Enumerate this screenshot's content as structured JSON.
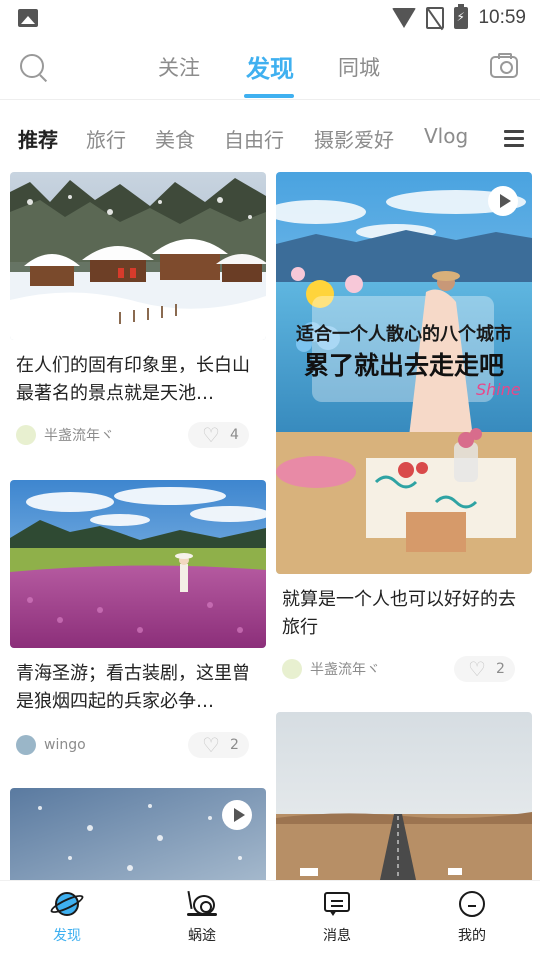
{
  "status_bar": {
    "time": "10:59"
  },
  "top_tabs": [
    {
      "label": "关注",
      "active": false
    },
    {
      "label": "发现",
      "active": true
    },
    {
      "label": "同城",
      "active": false
    }
  ],
  "categories": [
    {
      "label": "推荐",
      "active": true
    },
    {
      "label": "旅行",
      "active": false
    },
    {
      "label": "美食",
      "active": false
    },
    {
      "label": "自由行",
      "active": false
    },
    {
      "label": "摄影爱好",
      "active": false
    },
    {
      "label": "Vlog",
      "active": false
    }
  ],
  "feed": {
    "left": [
      {
        "title": "在人们的固有印象里，长白山最著名的景点就是天池…",
        "author": "半盏流年ヾ",
        "likes": "4",
        "image": "snowy-village",
        "is_video": false
      },
      {
        "title": "青海圣游；看古装剧，这里曾是狼烟四起的兵家必争…",
        "author": "wingo",
        "likes": "2",
        "image": "flower-field",
        "is_video": false
      },
      {
        "title": "",
        "author": "",
        "likes": "",
        "image": "snowy-blue",
        "is_video": true
      }
    ],
    "right": [
      {
        "title": "就算是一个人也可以好好的去旅行",
        "author": "半盏流年ヾ",
        "likes": "2",
        "image": "lakeside-picnic",
        "is_video": true,
        "overlay_line1": "适合一个人散心的八个城市",
        "overlay_line2": "累了就出去走走吧",
        "overlay_script": "Shine"
      },
      {
        "title": "",
        "author": "",
        "likes": "",
        "image": "desert-road",
        "is_video": false
      }
    ]
  },
  "bottom_nav": [
    {
      "label": "发现",
      "icon": "planet-icon",
      "active": true
    },
    {
      "label": "蜗途",
      "icon": "snail-icon",
      "active": false
    },
    {
      "label": "消息",
      "icon": "message-icon",
      "active": false
    },
    {
      "label": "我的",
      "icon": "profile-icon",
      "active": false
    }
  ],
  "colors": {
    "accent": "#3fb0f0",
    "text_primary": "#222222",
    "text_muted": "#8c8c8c"
  }
}
